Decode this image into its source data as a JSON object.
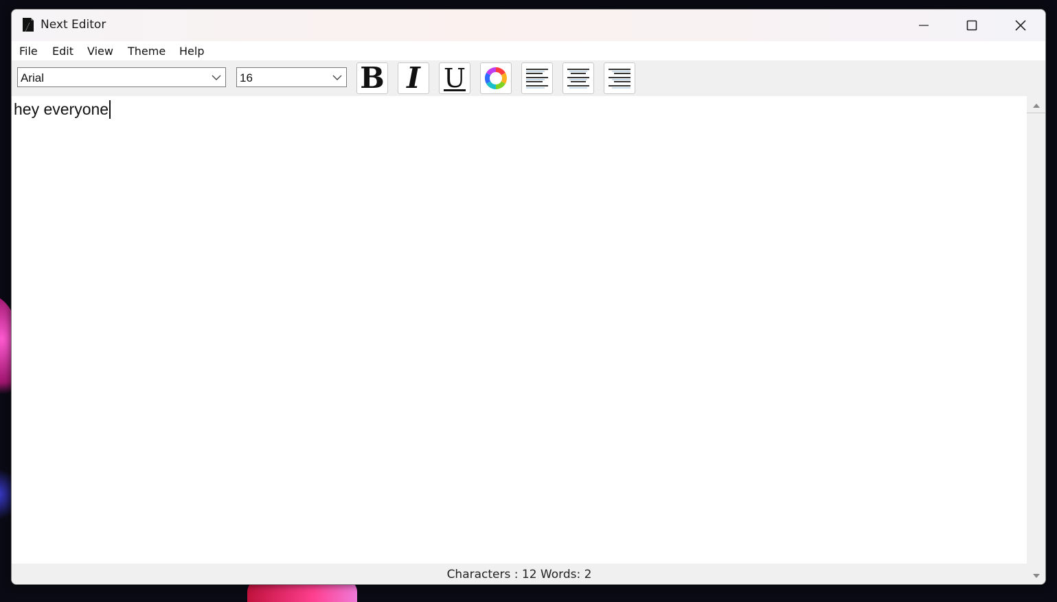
{
  "window": {
    "title": "Next Editor"
  },
  "menu": {
    "items": [
      "File",
      "Edit",
      "View",
      "Theme",
      "Help"
    ]
  },
  "toolbar": {
    "font_family": "Arial",
    "font_size": "16",
    "bold_label": "B",
    "italic_label": "I",
    "underline_label": "U"
  },
  "editor": {
    "content": "hey everyone"
  },
  "status": {
    "text": "Characters : 12 Words: 2"
  }
}
